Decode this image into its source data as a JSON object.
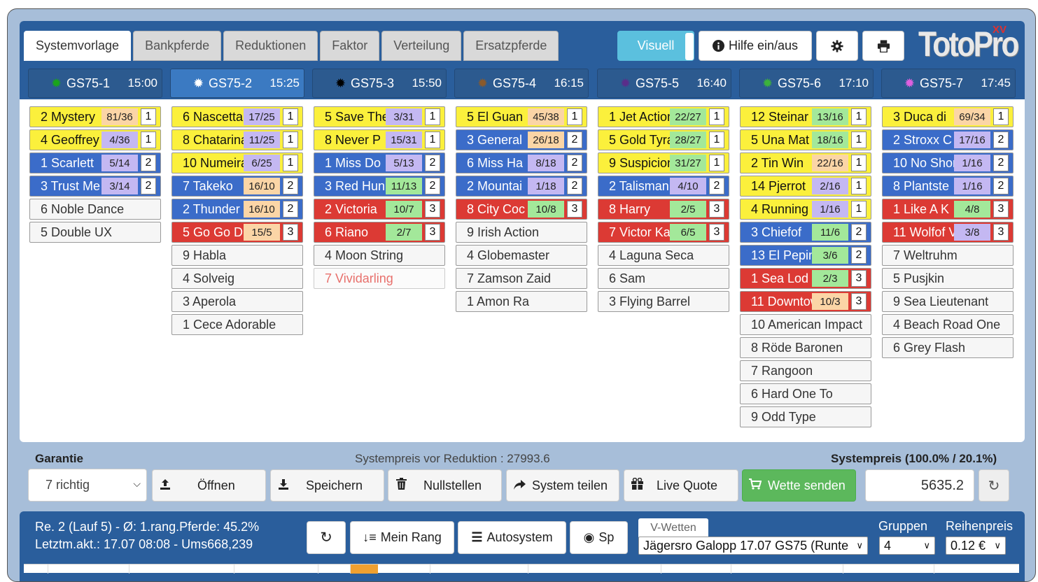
{
  "tabs": [
    "Systemvorlage",
    "Bankpferde",
    "Reduktionen",
    "Faktor",
    "Verteilung",
    "Ersatzpferde"
  ],
  "topbar": {
    "visuell": "Visuell",
    "hilfe": "Hilfe ein/aus"
  },
  "logo": {
    "text": "TotoPro",
    "badge": "XV"
  },
  "races": [
    {
      "name": "GS75-1",
      "time": "15:00",
      "dot_color": "#1aa51a"
    },
    {
      "name": "GS75-2",
      "time": "15:25",
      "dot_color": "#ffffff"
    },
    {
      "name": "GS75-3",
      "time": "15:50",
      "dot_color": "#000000"
    },
    {
      "name": "GS75-4",
      "time": "16:15",
      "dot_color": "#8b5a2b"
    },
    {
      "name": "GS75-5",
      "time": "16:40",
      "dot_color": "#5a2d8a"
    },
    {
      "name": "GS75-6",
      "time": "17:10",
      "dot_color": "#3cb23c"
    },
    {
      "name": "GS75-7",
      "time": "17:45",
      "dot_color": "#e060e0"
    }
  ],
  "columns": [
    [
      {
        "name": "2 Mystery",
        "pct": "81/36",
        "pct_color": "orange",
        "rank": "1",
        "color": "yellow"
      },
      {
        "name": "4 Geoffrey",
        "pct": "4/36",
        "pct_color": "lav",
        "rank": "1",
        "color": "yellow"
      },
      {
        "name": "1 Scarlett",
        "pct": "5/14",
        "pct_color": "lav",
        "rank": "2",
        "color": "blue"
      },
      {
        "name": "3 Trust Me",
        "pct": "3/14",
        "pct_color": "lav",
        "rank": "2",
        "color": "blue"
      },
      {
        "name": "6 Noble Dance",
        "color": "white"
      },
      {
        "name": "5 Double UX",
        "color": "white"
      }
    ],
    [
      {
        "name": "6 Nascetta",
        "pct": "17/25",
        "pct_color": "lav",
        "rank": "1",
        "color": "yellow"
      },
      {
        "name": "8 Chatarina",
        "pct": "11/25",
        "pct_color": "lav",
        "rank": "1",
        "color": "yellow"
      },
      {
        "name": "10 Numeira",
        "pct": "6/25",
        "pct_color": "lav",
        "rank": "1",
        "color": "yellow"
      },
      {
        "name": "7 Takeko",
        "pct": "16/10",
        "pct_color": "orange",
        "rank": "2",
        "color": "blue"
      },
      {
        "name": "2 Thunder",
        "pct": "16/10",
        "pct_color": "orange",
        "rank": "2",
        "color": "blue"
      },
      {
        "name": "5 Go Go D",
        "pct": "15/5",
        "pct_color": "orange",
        "rank": "3",
        "color": "red"
      },
      {
        "name": "9 Habla",
        "color": "white"
      },
      {
        "name": "4 Solveig",
        "color": "white"
      },
      {
        "name": "3 Aperola",
        "color": "white"
      },
      {
        "name": "1 Cece Adorable",
        "color": "white"
      }
    ],
    [
      {
        "name": "5 Save The",
        "pct": "3/31",
        "pct_color": "lav",
        "rank": "1",
        "color": "yellow"
      },
      {
        "name": "8 Never P",
        "pct": "15/31",
        "pct_color": "lav",
        "rank": "1",
        "color": "yellow"
      },
      {
        "name": "1 Miss Do",
        "pct": "5/13",
        "pct_color": "lav",
        "rank": "2",
        "color": "blue"
      },
      {
        "name": "3 Red Hun",
        "pct": "11/13",
        "pct_color": "green",
        "rank": "2",
        "color": "blue"
      },
      {
        "name": "2 Victoria",
        "pct": "10/7",
        "pct_color": "green",
        "rank": "3",
        "color": "red"
      },
      {
        "name": "6 Riano",
        "pct": "2/7",
        "pct_color": "green",
        "rank": "3",
        "color": "red"
      },
      {
        "name": "4 Moon String",
        "color": "white"
      },
      {
        "name": "7 Vividarling",
        "color": "faded"
      }
    ],
    [
      {
        "name": "5 El Guan",
        "pct": "45/38",
        "pct_color": "orange",
        "rank": "1",
        "color": "yellow"
      },
      {
        "name": "3 General",
        "pct": "26/18",
        "pct_color": "orange",
        "rank": "2",
        "color": "blue"
      },
      {
        "name": "6 Miss Ha",
        "pct": "8/18",
        "pct_color": "lav",
        "rank": "2",
        "color": "blue"
      },
      {
        "name": "2 Mountai",
        "pct": "1/18",
        "pct_color": "lav",
        "rank": "2",
        "color": "blue"
      },
      {
        "name": "8 City Coc",
        "pct": "10/8",
        "pct_color": "green",
        "rank": "3",
        "color": "red"
      },
      {
        "name": "9 Irish Action",
        "color": "white"
      },
      {
        "name": "4 Globemaster",
        "color": "white"
      },
      {
        "name": "7 Zamson Zaid",
        "color": "white"
      },
      {
        "name": "1 Amon Ra",
        "color": "white"
      }
    ],
    [
      {
        "name": "1 Jet Action",
        "pct": "22/27",
        "pct_color": "green",
        "rank": "1",
        "color": "yellow"
      },
      {
        "name": "5 Gold Tyra",
        "pct": "28/27",
        "pct_color": "green",
        "rank": "1",
        "color": "yellow"
      },
      {
        "name": "9 Suspicion",
        "pct": "31/27",
        "pct_color": "green",
        "rank": "1",
        "color": "yellow"
      },
      {
        "name": "2 Talisman",
        "pct": "4/10",
        "pct_color": "lav",
        "rank": "2",
        "color": "blue"
      },
      {
        "name": "8 Harry",
        "pct": "2/5",
        "pct_color": "green",
        "rank": "3",
        "color": "red"
      },
      {
        "name": "7 Victor Ka",
        "pct": "6/5",
        "pct_color": "green",
        "rank": "3",
        "color": "red"
      },
      {
        "name": "4 Laguna Seca",
        "color": "white"
      },
      {
        "name": "6 Sam",
        "color": "white"
      },
      {
        "name": "3 Flying Barrel",
        "color": "white"
      }
    ],
    [
      {
        "name": "12 Steinar",
        "pct": "13/16",
        "pct_color": "green",
        "rank": "1",
        "color": "yellow"
      },
      {
        "name": "5 Una Mat",
        "pct": "18/16",
        "pct_color": "green",
        "rank": "1",
        "color": "yellow"
      },
      {
        "name": "2 Tin Win",
        "pct": "22/16",
        "pct_color": "orange",
        "rank": "1",
        "color": "yellow"
      },
      {
        "name": "14 Pjerrot",
        "pct": "2/16",
        "pct_color": "lav",
        "rank": "1",
        "color": "yellow"
      },
      {
        "name": "4 Running",
        "pct": "1/16",
        "pct_color": "lav",
        "rank": "1",
        "color": "yellow"
      },
      {
        "name": "3 Chiefof",
        "pct": "11/6",
        "pct_color": "green",
        "rank": "2",
        "color": "blue"
      },
      {
        "name": "13 El Pepin",
        "pct": "3/6",
        "pct_color": "green",
        "rank": "2",
        "color": "blue"
      },
      {
        "name": "1 Sea Lod",
        "pct": "2/3",
        "pct_color": "green",
        "rank": "3",
        "color": "red"
      },
      {
        "name": "11 Downtow",
        "pct": "10/3",
        "pct_color": "orange",
        "rank": "3",
        "color": "red"
      },
      {
        "name": "10 American Impact",
        "color": "white"
      },
      {
        "name": "8 Röde Baronen",
        "color": "white"
      },
      {
        "name": "7 Rangoon",
        "color": "white"
      },
      {
        "name": "6 Hard One To",
        "color": "white"
      },
      {
        "name": "9 Odd Type",
        "color": "white"
      }
    ],
    [
      {
        "name": "3 Duca di",
        "pct": "69/34",
        "pct_color": "orange",
        "rank": "1",
        "color": "yellow"
      },
      {
        "name": "2 Stroxx C",
        "pct": "17/16",
        "pct_color": "lav",
        "rank": "2",
        "color": "blue"
      },
      {
        "name": "10 No Shor",
        "pct": "1/16",
        "pct_color": "lav",
        "rank": "2",
        "color": "blue"
      },
      {
        "name": "8 Plantste",
        "pct": "1/16",
        "pct_color": "lav",
        "rank": "2",
        "color": "blue"
      },
      {
        "name": "1 Like A K",
        "pct": "4/8",
        "pct_color": "green",
        "rank": "3",
        "color": "red"
      },
      {
        "name": "11 Wolfof V",
        "pct": "3/8",
        "pct_color": "lav",
        "rank": "3",
        "color": "red"
      },
      {
        "name": "7 Weltruhm",
        "color": "white"
      },
      {
        "name": "5 Pusjkin",
        "color": "white"
      },
      {
        "name": "9 Sea Lieutenant",
        "color": "white"
      },
      {
        "name": "4 Beach Road One",
        "color": "white"
      },
      {
        "name": "6 Grey Flash",
        "color": "white"
      }
    ]
  ],
  "actions": {
    "garantie_label": "Garantie",
    "systempreis_vor": "Systempreis vor Reduktion : 27993.6",
    "systempreis_label": "Systempreis (100.0% / 20.1%)",
    "garantie_value": "7 richtig",
    "open": "Öffnen",
    "save": "Speichern",
    "reset": "Nullstellen",
    "share": "System teilen",
    "live": "Live Quote",
    "send": "Wette senden",
    "price": "5635.2"
  },
  "bottom": {
    "line1": "Re. 2 (Lauf 5) - Ø: 1.rang.Pferde: 45.2%",
    "line2": "Letztm.akt.: 17.07 08:08 - Ums668,239",
    "mein_rang": "Mein Rang",
    "autosystem": "Autosystem",
    "sp": "Sp",
    "vwetten": "V-Wetten",
    "race_select": "Jägersro Galopp 17.07 GS75 (Runte",
    "gruppen_label": "Gruppen",
    "gruppen_value": "4",
    "reihenpreis_label": "Reihenpreis",
    "reihenpreis_value": "0.12 €"
  }
}
